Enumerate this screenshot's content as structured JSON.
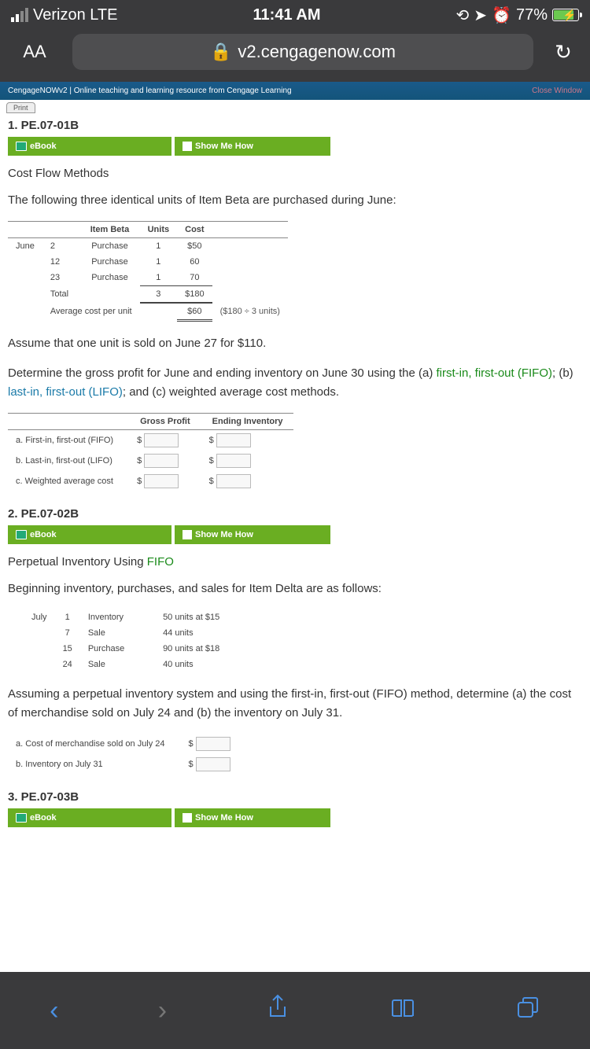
{
  "status": {
    "carrier": "Verizon  LTE",
    "time": "11:41 AM",
    "battery": "77%"
  },
  "address": {
    "aa": "AA",
    "domain": "v2.cengagenow.com"
  },
  "strip": {
    "title": "CengageNOWv2 | Online teaching and learning resource from Cengage Learning",
    "close": "Close Window",
    "print": "Print"
  },
  "buttons": {
    "ebook": "eBook",
    "showme": "Show Me How"
  },
  "q1": {
    "num": "1. PE.07-01B",
    "title": "Cost Flow Methods",
    "intro": "The following three identical units of Item Beta are purchased during June:",
    "table": {
      "headers": {
        "h1": "Item Beta",
        "h2": "Units",
        "h3": "Cost"
      },
      "r1": {
        "month": "June",
        "day": "2",
        "type": "Purchase",
        "u": "1",
        "c": "$50"
      },
      "r2": {
        "day": "12",
        "type": "Purchase",
        "u": "1",
        "c": "60"
      },
      "r3": {
        "day": "23",
        "type": "Purchase",
        "u": "1",
        "c": "70"
      },
      "total": {
        "label": "Total",
        "u": "3",
        "c": "$180"
      },
      "avg": {
        "label": "Average cost per unit",
        "c": "$60",
        "note": "($180 ÷ 3 units)"
      }
    },
    "assume": "Assume that one unit is sold on June 27 for $110.",
    "determine_a": "Determine the gross profit for June and ending inventory on June 30 using the (a) ",
    "fifo": "first-in, first-out (FIFO)",
    "sep1": "; (b) ",
    "lifo": "last-in, first-out (LIFO)",
    "sep2": "; and (c) weighted average cost methods.",
    "ans": {
      "h1": "Gross Profit",
      "h2": "Ending Inventory",
      "a": "a. First-in, first-out (FIFO)",
      "b": "b. Last-in, first-out (LIFO)",
      "c": "c. Weighted average cost"
    }
  },
  "q2": {
    "num": "2. PE.07-02B",
    "title_a": "Perpetual Inventory Using ",
    "title_b": "FIFO",
    "intro": "Beginning inventory, purchases, and sales for Item Delta are as follows:",
    "table": {
      "r1": {
        "m": "July",
        "d": "1",
        "t": "Inventory",
        "v": "50 units at $15"
      },
      "r2": {
        "d": "7",
        "t": "Sale",
        "v": "44 units"
      },
      "r3": {
        "d": "15",
        "t": "Purchase",
        "v": "90 units at $18"
      },
      "r4": {
        "d": "24",
        "t": "Sale",
        "v": "40 units"
      }
    },
    "assume": "Assuming a perpetual inventory system and using the first-in, first-out (FIFO) method, determine (a) the cost of merchandise sold on July 24 and (b) the inventory on July 31.",
    "ans": {
      "a": "a. Cost of merchandise sold on July 24",
      "b": "b. Inventory on July 31"
    }
  },
  "q3": {
    "num": "3. PE.07-03B"
  }
}
